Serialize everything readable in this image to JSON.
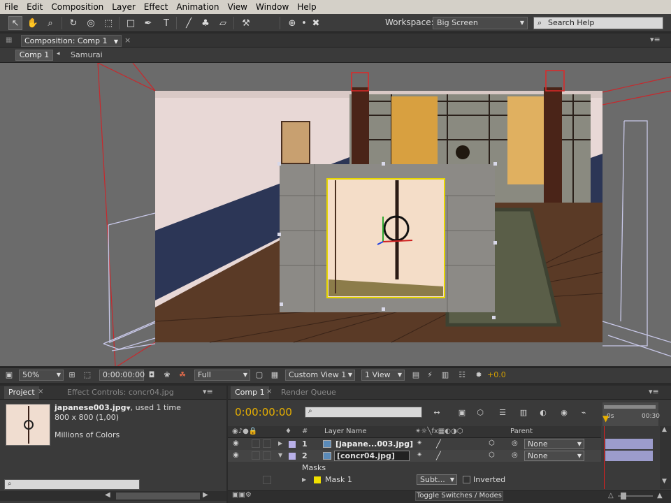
{
  "menu": [
    "File",
    "Edit",
    "Composition",
    "Layer",
    "Effect",
    "Animation",
    "View",
    "Window",
    "Help"
  ],
  "toolbar": {
    "workspace_label": "Workspace:",
    "workspace_value": "Big Screen",
    "search_placeholder": "Search Help"
  },
  "comp_panel": {
    "tab_label": "Composition: Comp 1",
    "crumbs": [
      "Comp 1",
      "Samurai"
    ]
  },
  "viewer_bar": {
    "zoom": "50%",
    "timecode": "0:00:00:00",
    "resolution": "Full",
    "view": "Custom View 1",
    "view_count": "1 View",
    "exposure": "+0.0"
  },
  "project_panel": {
    "tabs": [
      "Project",
      "Effect Controls: concr04.jpg"
    ],
    "file_name": "japanese003.jpg",
    "usage": ", used 1 time",
    "dimensions": "800 x 800 (1,00)",
    "colors": "Millions of Colors"
  },
  "timeline": {
    "tabs": [
      "Comp 1",
      "Render Queue"
    ],
    "timecode": "0:00:00:00",
    "columns": {
      "layer_name": "Layer Name",
      "parent": "Parent",
      "hash": "#"
    },
    "ruler": [
      "0s",
      "00:30"
    ],
    "layers": [
      {
        "num": "1",
        "name": "[japane...003.jpg]",
        "parent": "None"
      },
      {
        "num": "2",
        "name": "[concr04.jpg]",
        "parent": "None"
      }
    ],
    "masks_label": "Masks",
    "mask": {
      "name": "Mask 1",
      "mode": "Subt...",
      "inverted": "Inverted"
    },
    "toggle_label": "Toggle Switches / Modes"
  }
}
